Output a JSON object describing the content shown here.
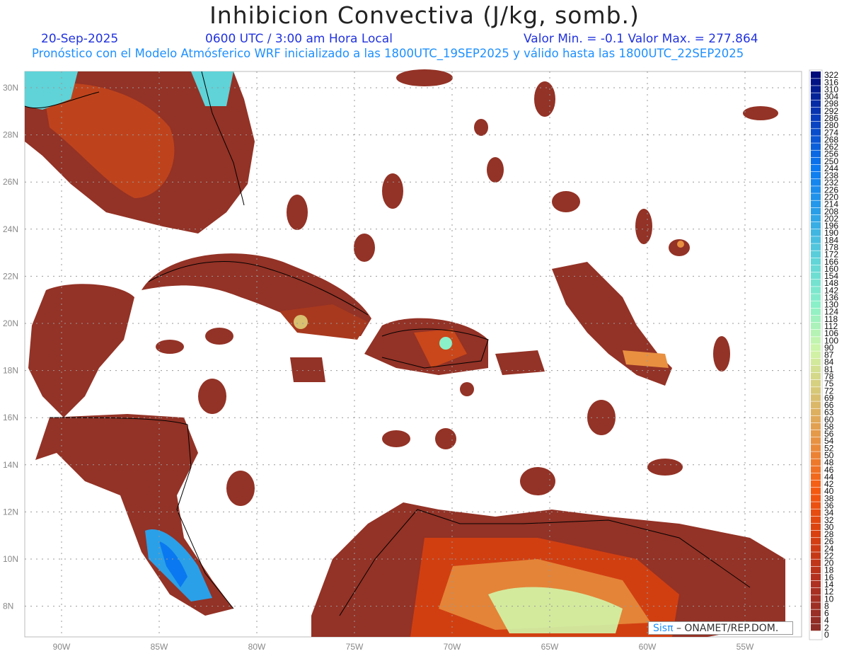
{
  "header": {
    "title": "Inhibicion Convectiva (J/kg, somb.)",
    "date": "20-Sep-2025",
    "time": "0600 UTC / 3:00 am Hora Local",
    "min_max": "Valor Min. = -0.1  Valor Max. = 277.864",
    "subtitle": "Pronóstico con el Modelo Atmósferico WRF inicializado a las 1800UTC_19SEP2025 y válido hasta las  1800UTC_22SEP2025"
  },
  "map": {
    "lon_labels": [
      "90W",
      "85W",
      "80W",
      "75W",
      "70W",
      "65W",
      "60W",
      "55W"
    ],
    "lat_labels": [
      "30N",
      "28N",
      "26N",
      "24N",
      "22N",
      "20N",
      "18N",
      "16N",
      "14N",
      "12N",
      "10N",
      "8N"
    ]
  },
  "colorbar": {
    "levels": [
      "322",
      "316",
      "310",
      "304",
      "298",
      "292",
      "286",
      "280",
      "274",
      "268",
      "262",
      "256",
      "250",
      "244",
      "238",
      "232",
      "226",
      "220",
      "214",
      "208",
      "202",
      "196",
      "190",
      "184",
      "178",
      "172",
      "166",
      "160",
      "154",
      "148",
      "142",
      "136",
      "130",
      "124",
      "118",
      "112",
      "106",
      "100",
      "90",
      "87",
      "84",
      "81",
      "78",
      "75",
      "72",
      "69",
      "66",
      "63",
      "60",
      "58",
      "56",
      "54",
      "52",
      "50",
      "48",
      "46",
      "44",
      "42",
      "40",
      "38",
      "36",
      "34",
      "32",
      "30",
      "28",
      "26",
      "24",
      "22",
      "20",
      "18",
      "16",
      "14",
      "12",
      "10",
      "8",
      "6",
      "4",
      "2",
      "0"
    ],
    "stops": [
      "#000c7a",
      "#0a3fbf",
      "#0a78f0",
      "#2aa0e8",
      "#5fd3d8",
      "#8af0c8",
      "#d0f5a8",
      "#d8c070",
      "#e89040",
      "#f55a10",
      "#d84010",
      "#b03020",
      "#8e2e28",
      "#ffffff"
    ]
  },
  "credit": {
    "logo": "Sisπ",
    "text": " – ONAMET/REP.DOM."
  }
}
